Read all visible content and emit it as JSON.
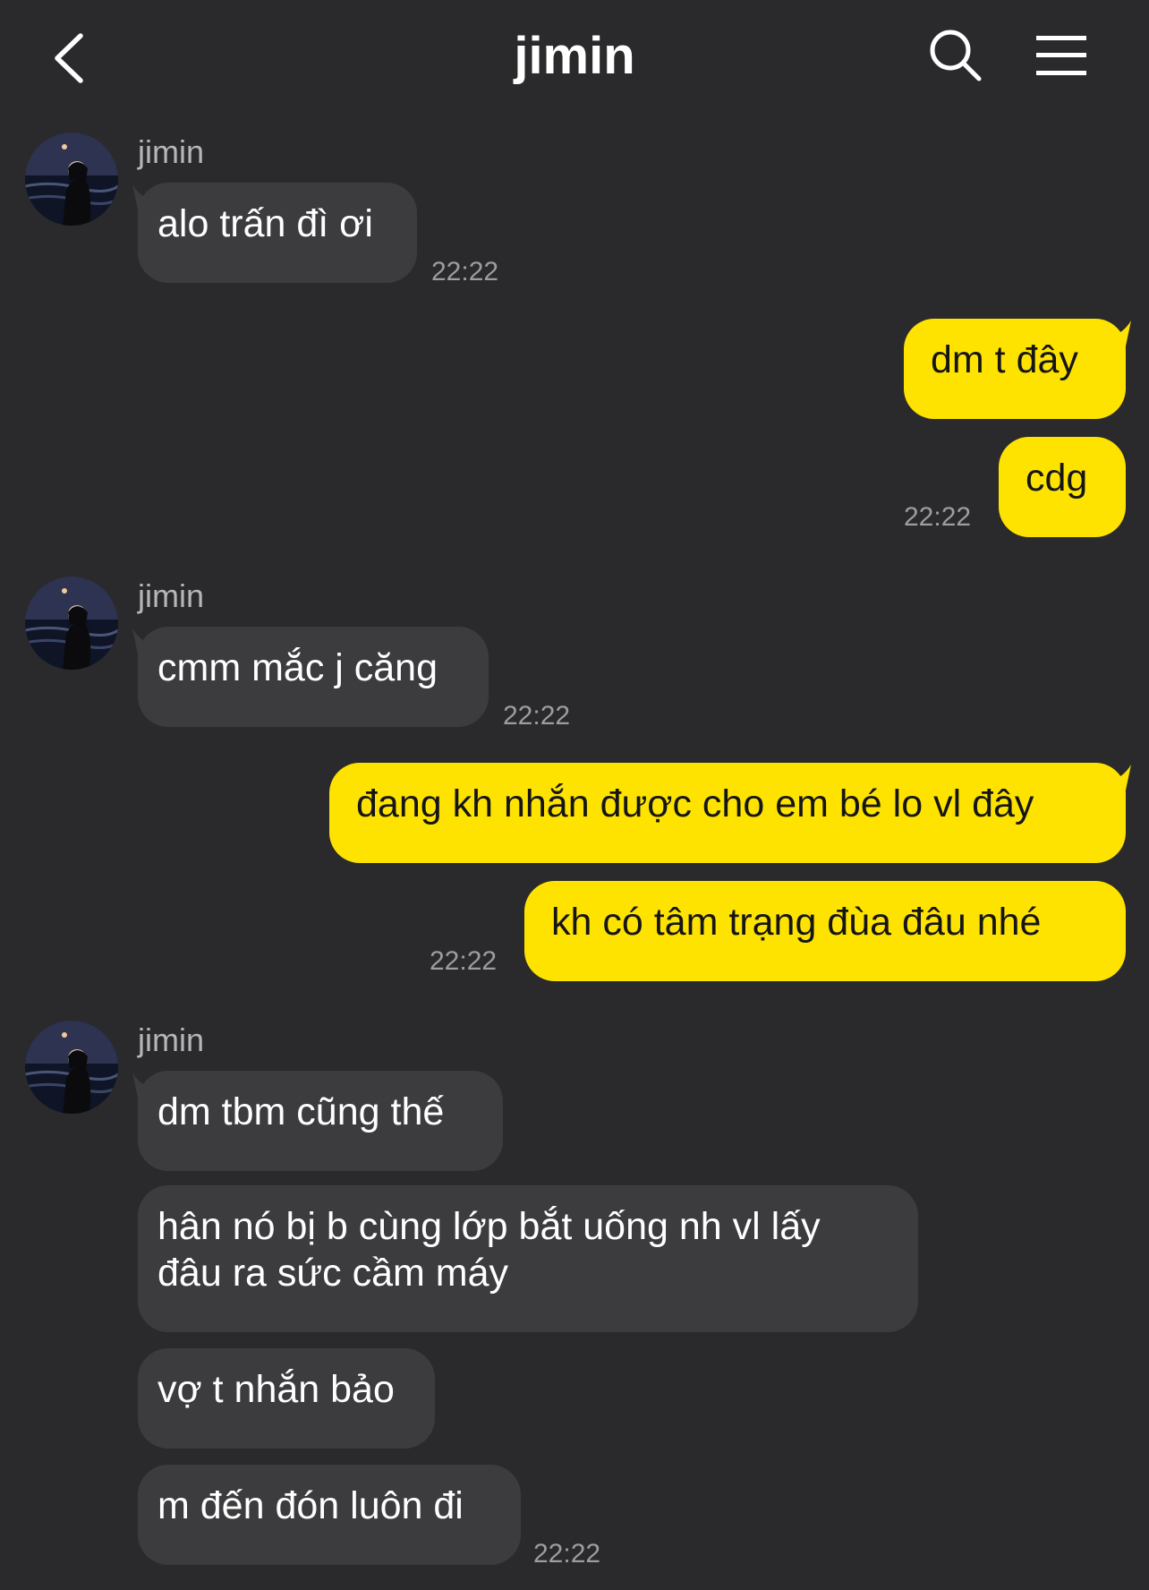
{
  "header": {
    "title": "jimin",
    "back_icon": "chevron-left-icon",
    "search_icon": "search-icon",
    "menu_icon": "hamburger-menu-icon"
  },
  "colors": {
    "background": "#2a2a2c",
    "incoming_bubble": "#3c3c3f",
    "outgoing_bubble": "#ffe300",
    "timestamp": "#9d9da1"
  },
  "messages": [
    {
      "sender": "jimin",
      "texts": [
        "alo trấn đì ơi"
      ],
      "time": "22:22"
    },
    {
      "outgoing": true,
      "texts": [
        "dm t đây",
        "cdg"
      ],
      "time": "22:22"
    },
    {
      "sender": "jimin",
      "texts": [
        "cmm mắc j căng"
      ],
      "time": "22:22"
    },
    {
      "outgoing": true,
      "texts": [
        "đang kh nhắn được cho em bé lo vl đây",
        "kh có tâm trạng đùa đâu nhé"
      ],
      "time": "22:22"
    },
    {
      "sender": "jimin",
      "texts": [
        "dm tbm cũng thế",
        "hân nó bị b cùng lớp bắt uống nh vl lấy\nđâu ra sức cầm máy",
        "vợ t nhắn bảo",
        "m đến đón luôn đi"
      ],
      "time": "22:22"
    }
  ]
}
